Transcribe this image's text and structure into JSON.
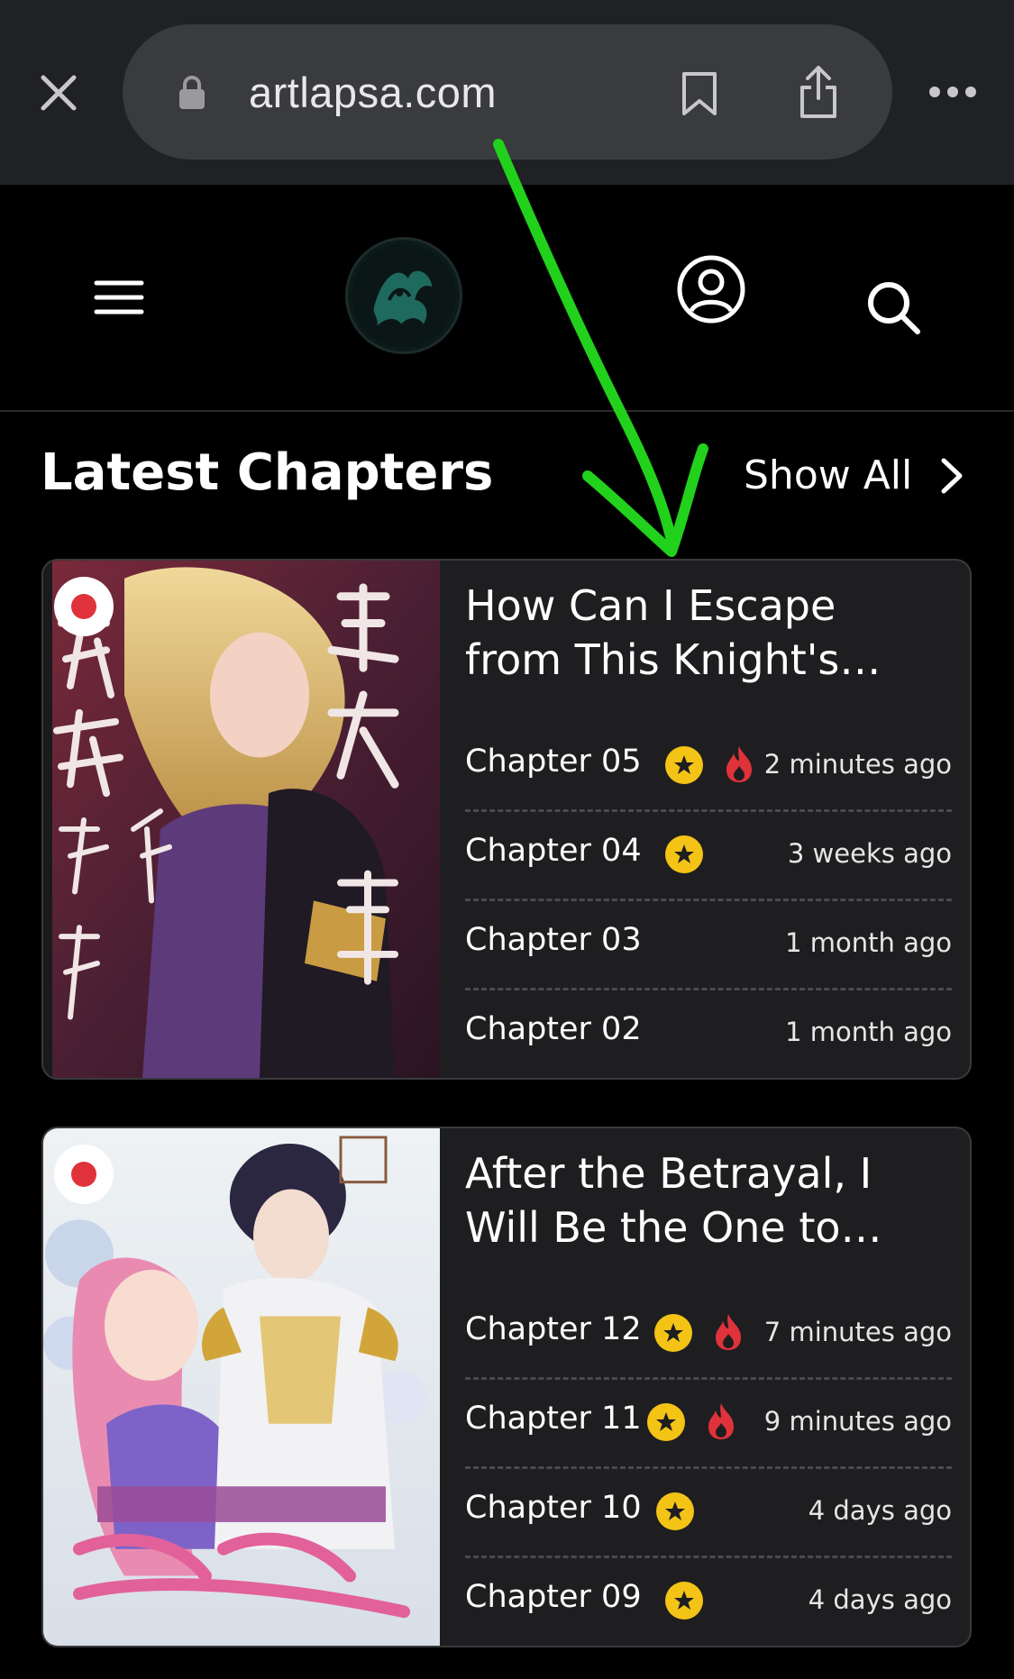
{
  "browser": {
    "url": "artlapsa.com",
    "icons": {
      "close": "close-icon",
      "lock": "lock-icon",
      "bookmark": "bookmark-icon",
      "share": "share-icon",
      "more": "more-icon"
    }
  },
  "site_header": {
    "icons": {
      "menu": "menu-icon",
      "logo": "site-logo",
      "profile": "profile-icon",
      "search": "search-icon"
    }
  },
  "section": {
    "title": "Latest Chapters",
    "show_all_label": "Show All"
  },
  "cards": [
    {
      "title_line1": "How Can I Escape",
      "title_line2": "from This Knight's…",
      "chapters": [
        {
          "name": "Chapter 05",
          "star": true,
          "hot": true,
          "time": "2 minutes ago"
        },
        {
          "name": "Chapter 04",
          "star": true,
          "hot": false,
          "time": "3 weeks ago"
        },
        {
          "name": "Chapter 03",
          "star": false,
          "hot": false,
          "time": "1 month ago"
        },
        {
          "name": "Chapter 02",
          "star": false,
          "hot": false,
          "time": "1 month ago"
        }
      ]
    },
    {
      "title_line1": "After the Betrayal, I",
      "title_line2": "Will Be the One to…",
      "chapters": [
        {
          "name": "Chapter 12",
          "star": true,
          "hot": true,
          "time": "7 minutes ago"
        },
        {
          "name": "Chapter 11",
          "star": true,
          "hot": true,
          "time": "9 minutes ago"
        },
        {
          "name": "Chapter 10",
          "star": true,
          "hot": false,
          "time": "4 days ago"
        },
        {
          "name": "Chapter 09",
          "star": true,
          "hot": false,
          "time": "4 days ago"
        }
      ]
    }
  ],
  "colors": {
    "accent_star": "#f3c316",
    "hot": "#e0323a",
    "annotation_arrow": "#22d11b"
  }
}
